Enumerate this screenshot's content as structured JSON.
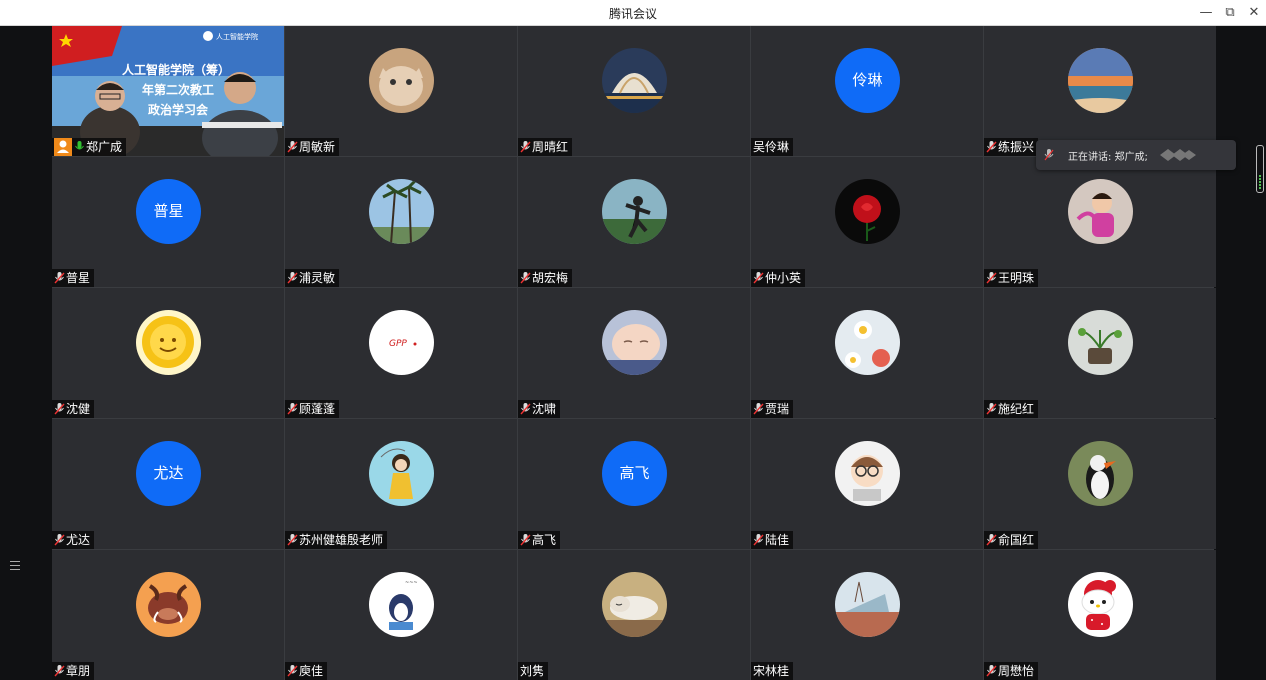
{
  "window": {
    "title": "腾讯会议",
    "minimize": "—",
    "restore": "⧉",
    "close": "✕"
  },
  "speaking_toast": {
    "label": "正在讲话: 郑广成;"
  },
  "accent_color": "#0f6bf7",
  "active_speaker_border": "#2fbf4a",
  "participants": [
    {
      "name": "郑广成",
      "avatar_type": "video",
      "mic": "on"
    },
    {
      "name": "周敏新",
      "avatar_type": "cat-photo",
      "mic": "muted"
    },
    {
      "name": "周晴红",
      "avatar_type": "building-photo",
      "mic": "muted"
    },
    {
      "name": "吴伶琳",
      "avatar_type": "text",
      "avatar_text": "伶琳",
      "mic": "none"
    },
    {
      "name": "练振兴",
      "avatar_type": "beach-photo",
      "mic": "muted"
    },
    {
      "name": "普星",
      "avatar_type": "text",
      "avatar_text": "普星",
      "mic": "muted"
    },
    {
      "name": "浦灵敏",
      "avatar_type": "palm-photo",
      "mic": "muted"
    },
    {
      "name": "胡宏梅",
      "avatar_type": "person-photo",
      "mic": "muted"
    },
    {
      "name": "仲小英",
      "avatar_type": "rose-photo",
      "mic": "muted"
    },
    {
      "name": "王明珠",
      "avatar_type": "girl-photo",
      "mic": "muted"
    },
    {
      "name": "沈健",
      "avatar_type": "sun-drawing",
      "mic": "muted"
    },
    {
      "name": "顾蓬蓬",
      "avatar_type": "text-sketch",
      "avatar_text": "GPP",
      "mic": "muted"
    },
    {
      "name": "沈啸",
      "avatar_type": "baby-photo",
      "mic": "muted"
    },
    {
      "name": "贾瑞",
      "avatar_type": "flower-photo",
      "mic": "muted"
    },
    {
      "name": "施纪红",
      "avatar_type": "plant-photo",
      "mic": "muted"
    },
    {
      "name": "尤达",
      "avatar_type": "text",
      "avatar_text": "尤达",
      "mic": "muted"
    },
    {
      "name": "苏州健雄殷老师",
      "avatar_type": "illustration",
      "mic": "muted"
    },
    {
      "name": "高飞",
      "avatar_type": "text",
      "avatar_text": "高飞",
      "mic": "muted"
    },
    {
      "name": "陆佳",
      "avatar_type": "cartoon-face",
      "mic": "muted"
    },
    {
      "name": "俞国红",
      "avatar_type": "puffin-photo",
      "mic": "muted"
    },
    {
      "name": "章朋",
      "avatar_type": "cartoon-boar",
      "mic": "muted"
    },
    {
      "name": "庾佳",
      "avatar_type": "cartoon-penguin",
      "mic": "muted"
    },
    {
      "name": "刘隽",
      "avatar_type": "cat-sleep-photo",
      "mic": "none"
    },
    {
      "name": "宋林桂",
      "avatar_type": "boat-photo",
      "mic": "none"
    },
    {
      "name": "周懋怡",
      "avatar_type": "hello-kitty",
      "mic": "muted"
    }
  ],
  "video_tile": {
    "banner_line1": "人工智能学院（筹）",
    "banner_line2": "年第二次教工",
    "banner_line3": "政治学习会",
    "logo_text": "人工智能学院"
  }
}
